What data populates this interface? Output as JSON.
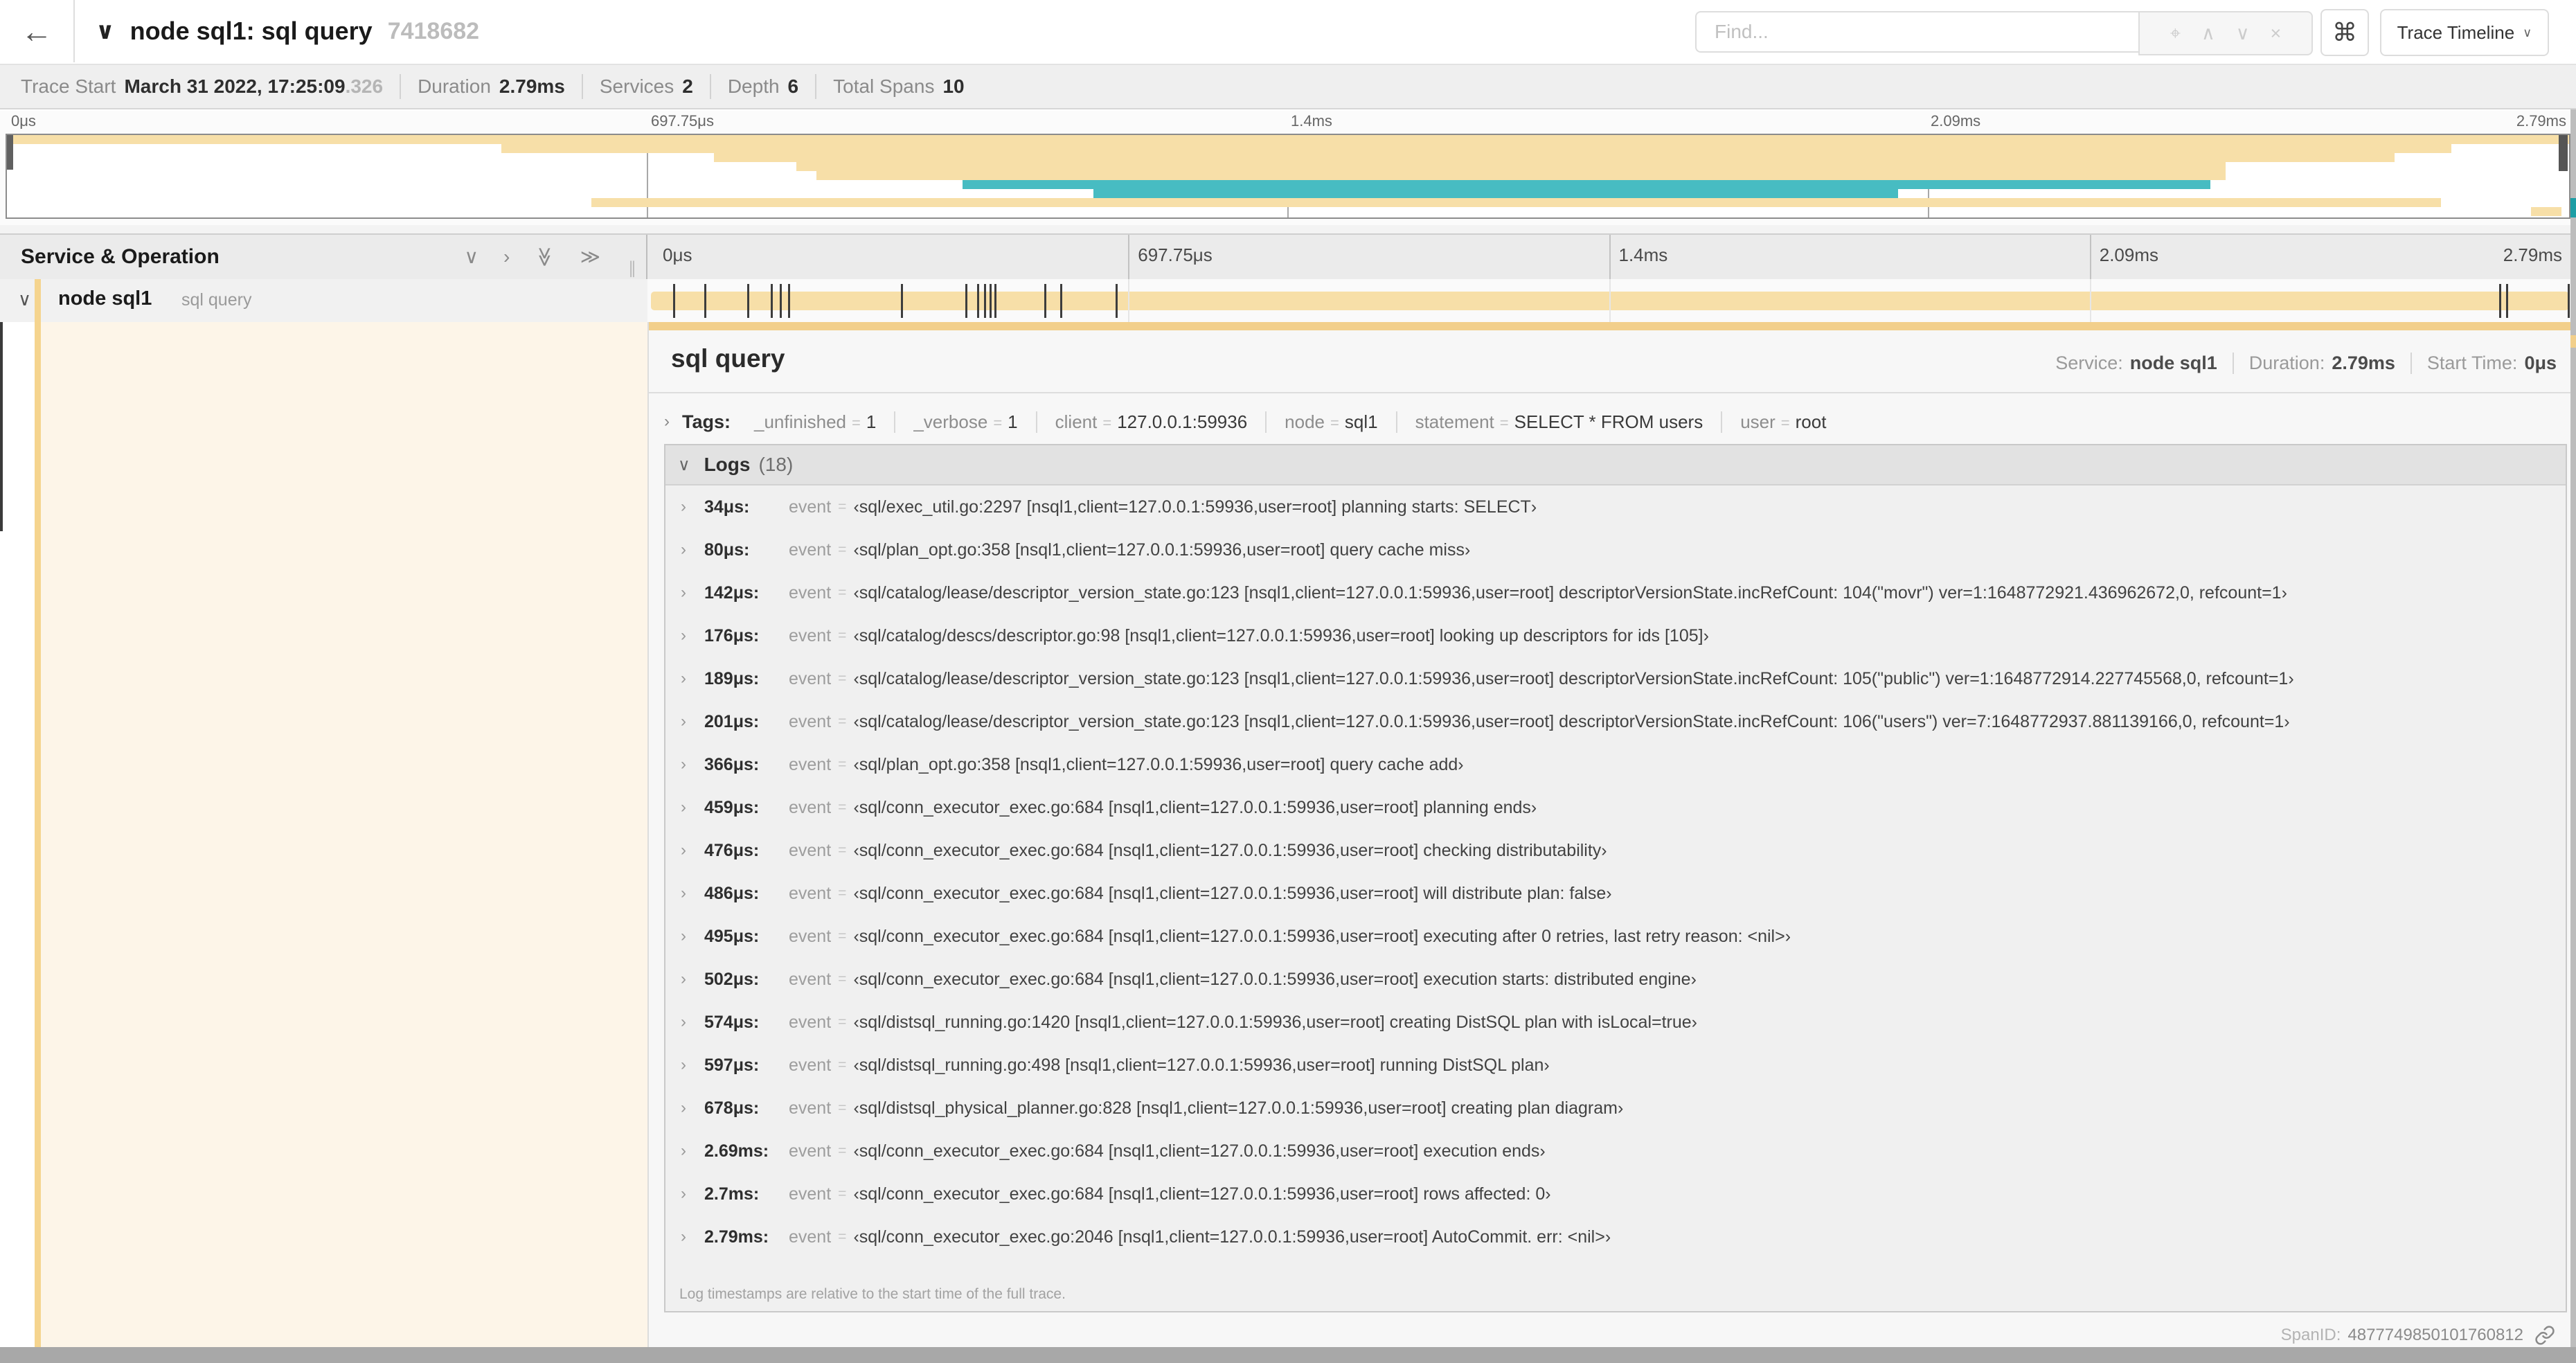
{
  "header": {
    "back_icon": "←",
    "collapse_icon": "∨",
    "title": "node sql1: sql query",
    "trace_id": "7418682",
    "find_placeholder": "Find...",
    "find_icons": [
      {
        "name": "locate-icon",
        "glyph": "⌖"
      },
      {
        "name": "prev-match-icon",
        "glyph": "∧"
      },
      {
        "name": "next-match-icon",
        "glyph": "∨"
      },
      {
        "name": "clear-search-icon",
        "glyph": "×"
      }
    ],
    "shortcut_icon": "⌘",
    "view_selector": "Trace Timeline",
    "view_caret": "∨"
  },
  "trace_info": {
    "items": [
      {
        "label": "Trace Start",
        "value": "March 31 2022, 17:25:09",
        "suffix": ".326"
      },
      {
        "label": "Duration",
        "value": "2.79ms",
        "suffix": ""
      },
      {
        "label": "Services",
        "value": "2",
        "suffix": ""
      },
      {
        "label": "Depth",
        "value": "6",
        "suffix": ""
      },
      {
        "label": "Total Spans",
        "value": "10",
        "suffix": ""
      }
    ]
  },
  "timeline": {
    "total_us": 2790,
    "ticks": [
      {
        "label": "0μs",
        "frac": 0
      },
      {
        "label": "697.75μs",
        "frac": 0.25
      },
      {
        "label": "1.4ms",
        "frac": 0.5
      },
      {
        "label": "2.09ms",
        "frac": 0.75
      },
      {
        "label": "2.79ms",
        "frac": 1
      }
    ],
    "minimap_spans": [
      {
        "row": 0,
        "start": 0,
        "end": 1,
        "color": "orange"
      },
      {
        "row": 1,
        "start": 0.193,
        "end": 0.954,
        "color": "orange"
      },
      {
        "row": 2,
        "start": 0.276,
        "end": 0.932,
        "color": "orange"
      },
      {
        "row": 3,
        "start": 0.308,
        "end": 0.866,
        "color": "orange"
      },
      {
        "row": 4,
        "start": 0.316,
        "end": 0.866,
        "color": "orange"
      },
      {
        "row": 5,
        "start": 0.373,
        "end": 0.86,
        "color": "teal"
      },
      {
        "row": 6,
        "start": 0.424,
        "end": 0.738,
        "color": "teal"
      },
      {
        "row": 7,
        "start": 0.228,
        "end": 0.95,
        "color": "orange"
      },
      {
        "row": 8,
        "start": 0.985,
        "end": 0.997,
        "color": "orange"
      }
    ]
  },
  "span_table": {
    "header_left": "Service & Operation",
    "collapse_icons": [
      {
        "name": "collapse-one-icon",
        "glyph": "∨"
      },
      {
        "name": "expand-one-icon",
        "glyph": "›"
      },
      {
        "name": "collapse-all-icon",
        "glyph": "≫"
      },
      {
        "name": "expand-all-icon",
        "glyph": "≫"
      }
    ],
    "resizer_grip": "∥",
    "row": {
      "chevron": "∨",
      "service": "node sql1",
      "operation": "sql query"
    }
  },
  "detail": {
    "title": "sql query",
    "info": [
      {
        "label": "Service:",
        "value": "node sql1"
      },
      {
        "label": "Duration:",
        "value": "2.79ms"
      },
      {
        "label": "Start Time:",
        "value": "0μs"
      }
    ],
    "tags": {
      "chevron": "›",
      "label": "Tags:",
      "eq": "=",
      "items": [
        {
          "key": "_unfinished",
          "value": "1"
        },
        {
          "key": "_verbose",
          "value": "1"
        },
        {
          "key": "client",
          "value": "127.0.0.1:59936"
        },
        {
          "key": "node",
          "value": "sql1"
        },
        {
          "key": "statement",
          "value": "SELECT * FROM users"
        },
        {
          "key": "user",
          "value": "root"
        }
      ]
    },
    "logs": {
      "chevron": "∨",
      "label": "Logs",
      "count": "(18)",
      "row_chevron": "›",
      "event_key": "event",
      "eq": "=",
      "items": [
        {
          "time": "34μs:",
          "us": 34,
          "text": "‹sql/exec_util.go:2297 [nsql1,client=127.0.0.1:59936,user=root] planning starts: SELECT›"
        },
        {
          "time": "80μs:",
          "us": 80,
          "text": "‹sql/plan_opt.go:358 [nsql1,client=127.0.0.1:59936,user=root] query cache miss›"
        },
        {
          "time": "142μs:",
          "us": 142,
          "text": "‹sql/catalog/lease/descriptor_version_state.go:123 [nsql1,client=127.0.0.1:59936,user=root] descriptorVersionState.incRefCount: 104(\"movr\") ver=1:1648772921.436962672,0, refcount=1›"
        },
        {
          "time": "176μs:",
          "us": 176,
          "text": "‹sql/catalog/descs/descriptor.go:98 [nsql1,client=127.0.0.1:59936,user=root] looking up descriptors for ids [105]›"
        },
        {
          "time": "189μs:",
          "us": 189,
          "text": "‹sql/catalog/lease/descriptor_version_state.go:123 [nsql1,client=127.0.0.1:59936,user=root] descriptorVersionState.incRefCount: 105(\"public\") ver=1:1648772914.227745568,0, refcount=1›"
        },
        {
          "time": "201μs:",
          "us": 201,
          "text": "‹sql/catalog/lease/descriptor_version_state.go:123 [nsql1,client=127.0.0.1:59936,user=root] descriptorVersionState.incRefCount: 106(\"users\") ver=7:1648772937.881139166,0, refcount=1›"
        },
        {
          "time": "366μs:",
          "us": 366,
          "text": "‹sql/plan_opt.go:358 [nsql1,client=127.0.0.1:59936,user=root] query cache add›"
        },
        {
          "time": "459μs:",
          "us": 459,
          "text": "‹sql/conn_executor_exec.go:684 [nsql1,client=127.0.0.1:59936,user=root] planning ends›"
        },
        {
          "time": "476μs:",
          "us": 476,
          "text": "‹sql/conn_executor_exec.go:684 [nsql1,client=127.0.0.1:59936,user=root] checking distributability›"
        },
        {
          "time": "486μs:",
          "us": 486,
          "text": "‹sql/conn_executor_exec.go:684 [nsql1,client=127.0.0.1:59936,user=root] will distribute plan: false›"
        },
        {
          "time": "495μs:",
          "us": 495,
          "text": "‹sql/conn_executor_exec.go:684 [nsql1,client=127.0.0.1:59936,user=root] executing after 0 retries, last retry reason: <nil>›"
        },
        {
          "time": "502μs:",
          "us": 502,
          "text": "‹sql/conn_executor_exec.go:684 [nsql1,client=127.0.0.1:59936,user=root] execution starts: distributed engine›"
        },
        {
          "time": "574μs:",
          "us": 574,
          "text": "‹sql/distsql_running.go:1420 [nsql1,client=127.0.0.1:59936,user=root] creating DistSQL plan with isLocal=true›"
        },
        {
          "time": "597μs:",
          "us": 597,
          "text": "‹sql/distsql_running.go:498 [nsql1,client=127.0.0.1:59936,user=root] running DistSQL plan›"
        },
        {
          "time": "678μs:",
          "us": 678,
          "text": "‹sql/distsql_physical_planner.go:828 [nsql1,client=127.0.0.1:59936,user=root] creating plan diagram›"
        },
        {
          "time": "2.69ms:",
          "us": 2690,
          "text": "‹sql/conn_executor_exec.go:684 [nsql1,client=127.0.0.1:59936,user=root] execution ends›"
        },
        {
          "time": "2.7ms:",
          "us": 2700,
          "text": "‹sql/conn_executor_exec.go:684 [nsql1,client=127.0.0.1:59936,user=root] rows affected: 0›"
        },
        {
          "time": "2.79ms:",
          "us": 2790,
          "text": "‹sql/conn_executor_exec.go:2046 [nsql1,client=127.0.0.1:59936,user=root] AutoCommit. err: <nil>›"
        }
      ],
      "note": "Log timestamps are relative to the start time of the full trace."
    },
    "footer": {
      "label": "SpanID:",
      "value": "4877749850101760812"
    }
  },
  "colors": {
    "span_orange": "#F7DFA8",
    "accent_orange": "#F2CF8B",
    "strip_orange": "#F5D48E",
    "teal": "#47BCC2",
    "cream": "#FDF5E8"
  }
}
